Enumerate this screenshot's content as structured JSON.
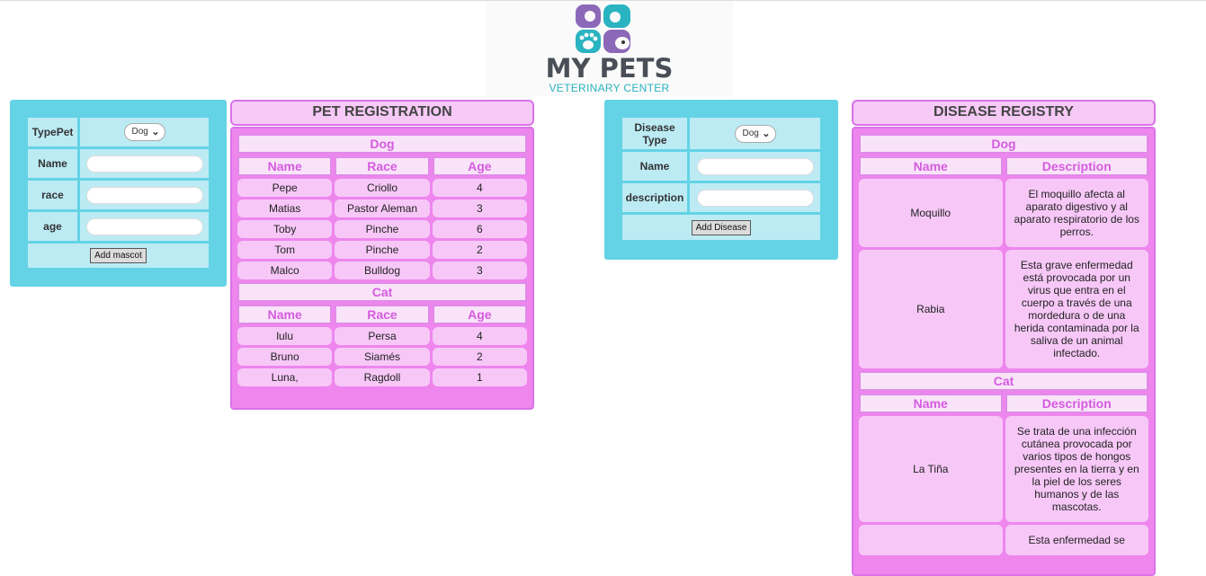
{
  "logo": {
    "title": "MY PETS",
    "subtitle": "VETERINARY CENTER"
  },
  "pet_form": {
    "type_label": "TypePet",
    "type_value": "Dog",
    "name_label": "Name",
    "race_label": "race",
    "age_label": "age",
    "submit_label": "Add mascot"
  },
  "pet_registry": {
    "title": "PET REGISTRATION",
    "columns": [
      "Name",
      "Race",
      "Age"
    ],
    "groups": [
      {
        "label": "Dog",
        "rows": [
          [
            "Pepe",
            "Criollo",
            "4"
          ],
          [
            "Matias",
            "Pastor Aleman",
            "3"
          ],
          [
            "Toby",
            "Pinche",
            "6"
          ],
          [
            "Tom",
            "Pinche",
            "2"
          ],
          [
            "Malco",
            "Bulldog",
            "3"
          ]
        ]
      },
      {
        "label": "Cat",
        "rows": [
          [
            "lulu",
            "Persa",
            "4"
          ],
          [
            "Bruno",
            "Siamés",
            "2"
          ],
          [
            "Luna,",
            "Ragdoll",
            "1"
          ]
        ]
      }
    ]
  },
  "disease_form": {
    "type_label": "Disease Type",
    "type_value": "Dog",
    "name_label": "Name",
    "description_label": "description",
    "submit_label": "Add Disease"
  },
  "disease_registry": {
    "title": "DISEASE REGISTRY",
    "columns": [
      "Name",
      "Description"
    ],
    "groups": [
      {
        "label": "Dog",
        "rows": [
          [
            "Moquillo",
            "El moquillo afecta al aparato digestivo y al aparato respiratorio de los perros."
          ],
          [
            "Rabia",
            "Esta grave enfermedad está provocada por un virus que entra en el cuerpo a través de una mordedura o de una herida contaminada por la saliva de un animal infectado."
          ]
        ]
      },
      {
        "label": "Cat",
        "rows": [
          [
            "La Tiña",
            "Se trata de una infección cutánea provocada por varios tipos de hongos presentes en la tierra y en la piel de los seres humanos y de las mascotas."
          ],
          [
            "",
            "Esta enfermedad se"
          ]
        ]
      }
    ]
  }
}
